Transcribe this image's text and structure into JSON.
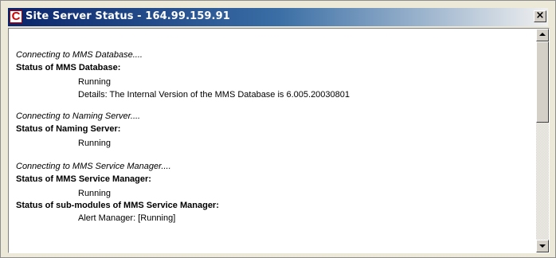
{
  "window": {
    "title": "Site Server Status - 164.99.159.91",
    "icon_letter": "C",
    "close_label": "×"
  },
  "log": [
    {
      "text": "Connecting to MMS Database....",
      "style": "italic"
    },
    {
      "text": "Status of MMS Database:",
      "style": "bold"
    },
    {
      "text": "Running",
      "style": "indent"
    },
    {
      "text": "Details: The Internal Version of the MMS Database is 6.005.20030801",
      "style": "indent"
    },
    {
      "text": "Connecting to Naming Server....",
      "style": "italic"
    },
    {
      "text": "Status of Naming Server:",
      "style": "bold"
    },
    {
      "text": "Running",
      "style": "indent"
    },
    {
      "text": "Connecting to MMS Service Manager....",
      "style": "italic"
    },
    {
      "text": "Status of MMS Service Manager:",
      "style": "bold"
    },
    {
      "text": "Running",
      "style": "indent"
    },
    {
      "text": "Status of sub-modules of MMS Service Manager:",
      "style": "bold"
    },
    {
      "text": "Alert Manager: [Running]",
      "style": "indent"
    }
  ]
}
